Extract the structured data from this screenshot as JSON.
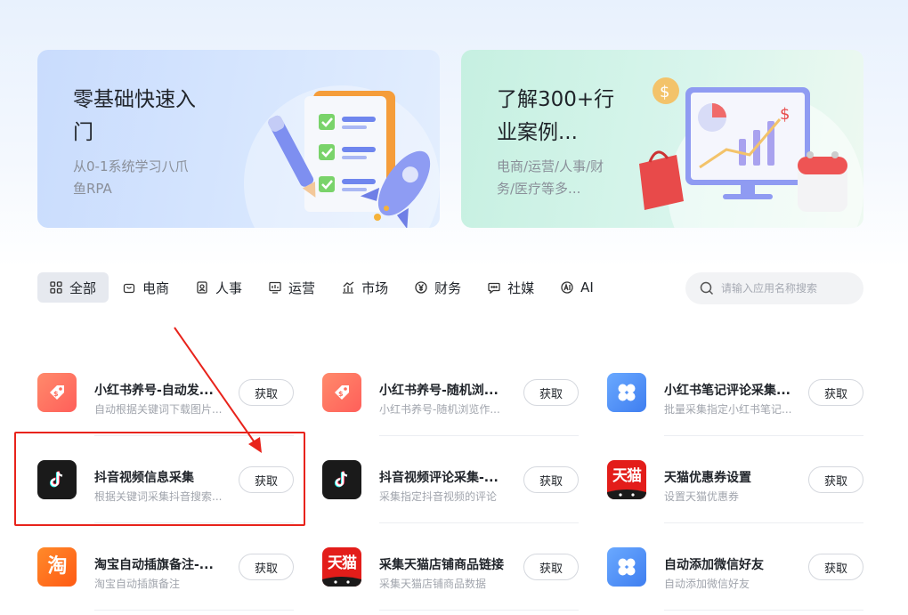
{
  "banners": [
    {
      "title": "零基础快速入门",
      "subtitle": "从0-1系统学习八爪鱼RPA"
    },
    {
      "title": "了解300+行业案例...",
      "subtitle": "电商/运营/人事/财务/医疗等多..."
    }
  ],
  "categories": [
    {
      "label": "全部",
      "icon": "grid-icon",
      "active": true
    },
    {
      "label": "电商",
      "icon": "shopping-bag-icon"
    },
    {
      "label": "人事",
      "icon": "id-badge-icon"
    },
    {
      "label": "运营",
      "icon": "monitor-chart-icon"
    },
    {
      "label": "市场",
      "icon": "bar-chart-icon"
    },
    {
      "label": "财务",
      "icon": "yen-coin-icon"
    },
    {
      "label": "社媒",
      "icon": "chat-bubble-icon"
    },
    {
      "label": "AI",
      "icon": "ai-icon"
    }
  ],
  "search": {
    "placeholder": "请输入应用名称搜索"
  },
  "get_label": "获取",
  "apps": [
    {
      "name": "小红书养号-自动发...",
      "desc": "自动根据关键词下载图片...",
      "icon": "xiaohongshu-tag-icon"
    },
    {
      "name": "小红书养号-随机浏...",
      "desc": "小红书养号-随机浏览作...",
      "icon": "xiaohongshu-tag-icon"
    },
    {
      "name": "小红书笔记评论采集...",
      "desc": "批量采集指定小红书笔记...",
      "icon": "clover-app-icon"
    },
    {
      "name": "抖音视频信息采集",
      "desc": "根据关键词采集抖音搜索...",
      "icon": "tiktok-icon"
    },
    {
      "name": "抖音视频评论采集-...",
      "desc": "采集指定抖音视频的评论",
      "icon": "tiktok-icon"
    },
    {
      "name": "天猫优惠券设置",
      "desc": "设置天猫优惠券",
      "icon": "tmall-icon",
      "icon_text": "天猫"
    },
    {
      "name": "淘宝自动插旗备注-...",
      "desc": "淘宝自动插旗备注",
      "icon": "taobao-icon",
      "icon_text": "淘"
    },
    {
      "name": "采集天猫店铺商品链接",
      "desc": "采集天猫店铺商品数据",
      "icon": "tmall-icon",
      "icon_text": "天猫"
    },
    {
      "name": "自动添加微信好友",
      "desc": "自动添加微信好友",
      "icon": "clover-app-icon"
    }
  ],
  "colors": {
    "annotation": "#e8231b",
    "tmall": "#e31d1a",
    "taobao": "#ff6a1e",
    "xhs": "#ff6b5a",
    "tiktok": "#1a1a1a",
    "clover": "#4a90f5"
  }
}
